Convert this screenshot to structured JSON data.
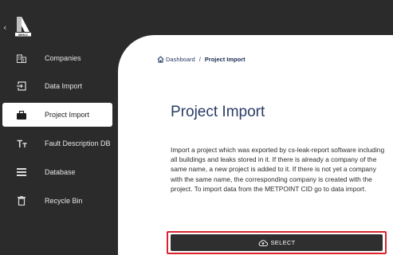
{
  "logo": {
    "text": "BEKO"
  },
  "sidebar": {
    "items": [
      {
        "label": "Companies",
        "icon": "building-icon"
      },
      {
        "label": "Data Import",
        "icon": "import-icon"
      },
      {
        "label": "Project Import",
        "icon": "briefcase-icon",
        "active": true
      },
      {
        "label": "Fault Description DB",
        "icon": "text-format-icon"
      },
      {
        "label": "Database",
        "icon": "list-icon"
      },
      {
        "label": "Recycle Bin",
        "icon": "trash-icon"
      }
    ]
  },
  "breadcrumb": {
    "home": "Dashboard",
    "separator": "/",
    "current": "Project Import"
  },
  "main": {
    "title": "Project Import",
    "description": "Import a project which was exported by cs-leak-report software including all buildings and leaks stored in it. If there is already a company of the same name, a new project is added to it. If there is not yet a company with the same name, the corresponding company is created with the project. To import data from the METPOINT CID go to data import.",
    "select_label": "SELECT"
  },
  "colors": {
    "sidebar_bg": "#2b2b2b",
    "content_bg": "#ffffff",
    "accent_blue": "#2a3c66",
    "highlight_red": "#d9232d"
  }
}
